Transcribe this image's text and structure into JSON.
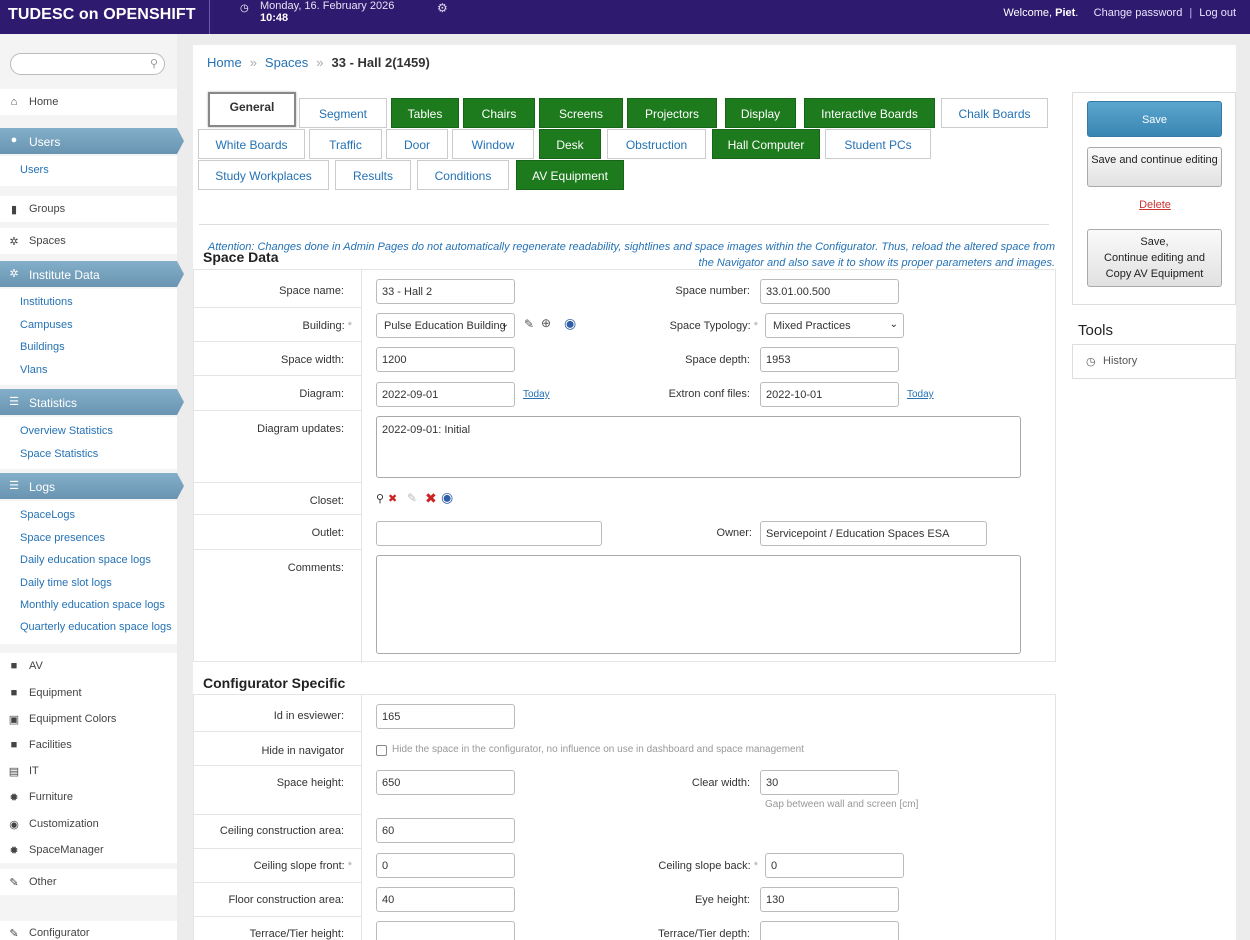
{
  "header": {
    "app_title": "TUDESC on OPENSHIFT",
    "date": "Monday, 16. February 2026",
    "time": "10:48",
    "welcome_prefix": "Welcome, ",
    "user_name": "Piet",
    "welcome_suffix": ".",
    "change_password": "Change password",
    "separator": "|",
    "log_out": "Log out"
  },
  "sidebar": {
    "search_placeholder": "",
    "home": "Home",
    "users_section": "Users",
    "users_link": "Users",
    "groups": "Groups",
    "spaces": "Spaces",
    "institute_section": "Institute Data",
    "institute_links": [
      "Institutions",
      "Campuses",
      "Buildings",
      "Vlans"
    ],
    "statistics_section": "Statistics",
    "statistics_links": [
      "Overview Statistics",
      "Space Statistics"
    ],
    "logs_section": "Logs",
    "logs_links": [
      "SpaceLogs",
      "Space presences",
      "Daily education space logs",
      "Daily time slot logs",
      "Monthly education space logs",
      "Quarterly education space logs"
    ],
    "group2": [
      "AV",
      "Equipment",
      "Equipment Colors",
      "Facilities",
      "IT",
      "Furniture",
      "Customization",
      "SpaceManager"
    ],
    "other": "Other",
    "configurator": "Configurator"
  },
  "breadcrumb": {
    "home": "Home",
    "spaces": "Spaces",
    "sep": "»",
    "current": "33 - Hall 2(1459)"
  },
  "tabs": [
    "General",
    "Segment",
    "Tables",
    "Chairs",
    "Screens",
    "Projectors",
    "Display",
    "Interactive Boards",
    "Chalk Boards",
    "White Boards",
    "Traffic",
    "Door",
    "Window",
    "Desk",
    "Obstruction",
    "Hall Computer",
    "Student PCs",
    "Study Workplaces",
    "Results",
    "Conditions",
    "AV Equipment"
  ],
  "attention": "Attention: Changes done in Admin Pages do not automatically regenerate readability, sightlines and space images within the Configurator. Thus, reload the altered space from the Navigator and also save it to show its proper parameters and images.",
  "space_data": {
    "title": "Space Data",
    "space_name_label": "Space name:",
    "space_name": "33 - Hall 2",
    "space_number_label": "Space number:",
    "space_number": "33.01.00.500",
    "building_label": "Building:",
    "building": "Pulse Education Building",
    "required_mark": "*",
    "typology_label": "Space Typology:",
    "typology": "Mixed Practices",
    "width_label": "Space width:",
    "width": "1200",
    "depth_label": "Space depth:",
    "depth": "1953",
    "diagram_label": "Diagram:",
    "diagram": "2022-09-01",
    "today": "Today",
    "extron_label": "Extron conf files:",
    "extron": "2022-10-01",
    "updates_label": "Diagram updates:",
    "updates": "2022-09-01: Initial",
    "closet_label": "Closet:",
    "outlet_label": "Outlet:",
    "outlet": "",
    "owner_label": "Owner:",
    "owner": "Servicepoint / Education Spaces ESA",
    "comments_label": "Comments:",
    "comments": ""
  },
  "configurator": {
    "title": "Configurator Specific",
    "esviewer_label": "Id in esviewer:",
    "esviewer": "165",
    "hide_label": "Hide in navigator",
    "hide_help": "Hide the space in the configurator, no influence on use in dashboard and space management",
    "height_label": "Space height:",
    "height": "650",
    "clear_label": "Clear width:",
    "clear": "30",
    "clear_help": "Gap between wall and screen [cm]",
    "ceiling_area_label": "Ceiling construction area:",
    "ceiling_area": "60",
    "slope_front_label": "Ceiling slope front:",
    "slope_front": "0",
    "slope_back_label": "Ceiling slope back:",
    "slope_back": "0",
    "floor_label": "Floor construction area:",
    "floor": "40",
    "eye_label": "Eye height:",
    "eye": "130",
    "tier_height_label": "Terrace/Tier height:",
    "tier_depth_label": "Terrace/Tier depth:"
  },
  "actions": {
    "save": "Save",
    "save_continue": "Save and continue editing",
    "delete": "Delete",
    "save_copy_1": "Save,",
    "save_copy_2": "Continue editing and",
    "save_copy_3": "Copy AV Equipment",
    "tools_title": "Tools",
    "history": "History"
  },
  "colors": {
    "header_bg": "#2e1a6e",
    "section_blue": "#6995b2",
    "tab_green": "#1d7a1d",
    "link_blue": "#2572b4"
  }
}
